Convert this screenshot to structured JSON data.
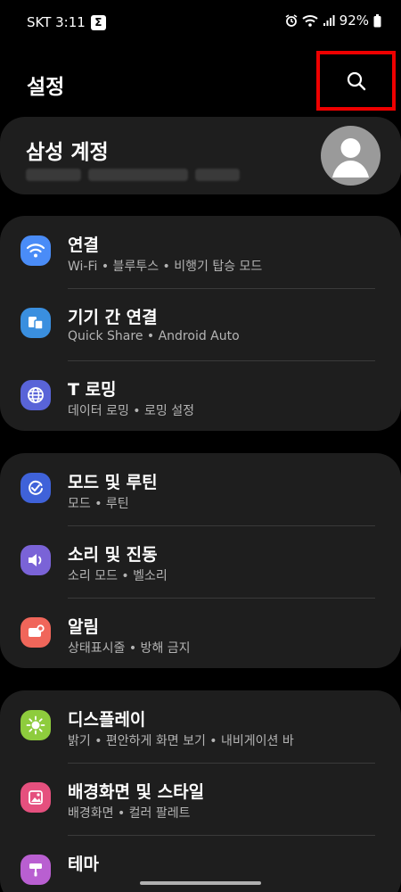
{
  "status_bar": {
    "carrier_time": "SKT 3:11",
    "badge": "Σ",
    "battery": "92%"
  },
  "header": {
    "title": "설정"
  },
  "account": {
    "title": "삼성 계정"
  },
  "colors": {
    "wifi": "#4a8cf7",
    "devices": "#3a8fdf",
    "globe": "#5964d8",
    "routine": "#3f62d9",
    "sound": "#7a63d7",
    "notif": "#f0665a",
    "display": "#8ecc3d",
    "wallpaper": "#e5507e",
    "theme": "#b95fd1"
  },
  "groups": [
    {
      "items": [
        {
          "icon": "wifi-icon",
          "title": "연결",
          "subtitle": "Wi-Fi • 블루투스 • 비행기 탑승 모드"
        },
        {
          "icon": "connected-devices-icon",
          "title": "기기 간 연결",
          "subtitle": "Quick Share • Android Auto"
        },
        {
          "icon": "globe-icon",
          "title": "T 로밍",
          "subtitle": "데이터 로밍 • 로밍 설정"
        }
      ]
    },
    {
      "items": [
        {
          "icon": "routine-icon",
          "title": "모드 및 루틴",
          "subtitle": "모드 • 루틴"
        },
        {
          "icon": "speaker-icon",
          "title": "소리 및 진동",
          "subtitle": "소리 모드 • 벨소리"
        },
        {
          "icon": "notification-icon",
          "title": "알림",
          "subtitle": "상태표시줄 • 방해 금지"
        }
      ]
    },
    {
      "items": [
        {
          "icon": "sun-icon",
          "title": "디스플레이",
          "subtitle": "밝기 • 편안하게 화면 보기 • 내비게이션 바"
        },
        {
          "icon": "wallpaper-icon",
          "title": "배경화면 및 스타일",
          "subtitle": "배경화면 • 컬러 팔레트"
        },
        {
          "icon": "theme-icon",
          "title": "테마",
          "subtitle": ""
        }
      ]
    }
  ]
}
